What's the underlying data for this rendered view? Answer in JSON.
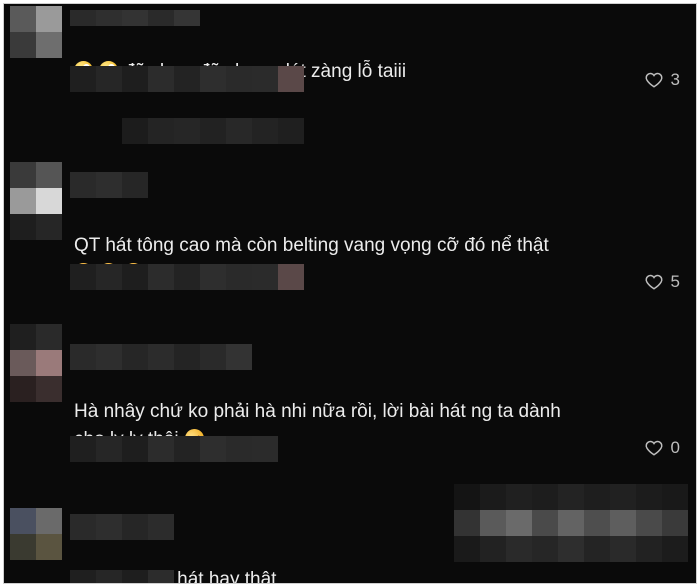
{
  "comments": [
    {
      "text": "đã chưa đã chưa, dát zàng lỗ taiii",
      "emojis": [
        "crazy-face",
        "crazy-face"
      ],
      "likes": "3"
    },
    {
      "text": "QT hát tông cao mà còn belting vang vọng cỡ đó nể thật",
      "emojis_after": [
        "smiling-face-with-hearts",
        "smiling-face-with-hearts",
        "smiling-face-with-hearts"
      ],
      "likes": "5"
    },
    {
      "text": "Hà nhây chứ ko phải hà nhi nữa rồi, lời bài hát ng ta dành\ncho ly ly thôi",
      "emojis_after": [
        "rofl-face"
      ],
      "likes": "0"
    },
    {
      "text": "Quốc Thiên hát hay thật"
    }
  ],
  "icons": {
    "like": "heart-outline-icon"
  },
  "colors": {
    "background": "#0a0a0a",
    "text": "#ececec",
    "muted": "#bdbdbd"
  }
}
